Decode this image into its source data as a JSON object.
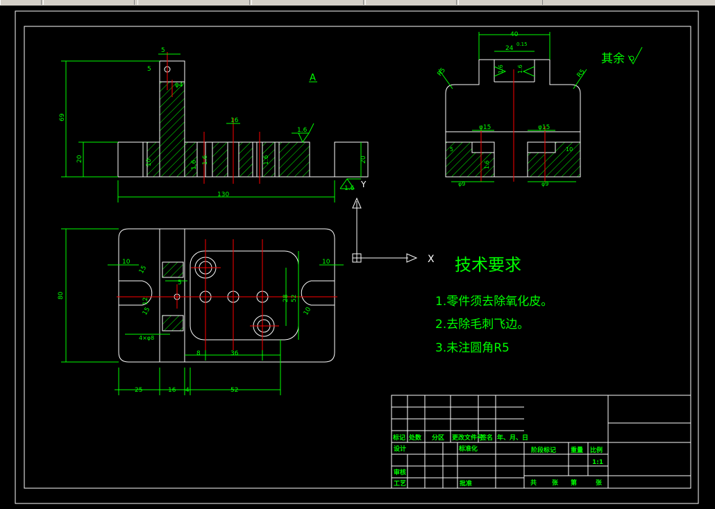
{
  "title_block": {
    "row_headers": [
      "标记",
      "处数",
      "分区",
      "更改文件号",
      "签名",
      "年、月、日"
    ],
    "design": "设计",
    "standardization": "标准化",
    "review": "审核",
    "process": "工艺",
    "approve": "批准",
    "stage_mark": "阶段标记",
    "weight": "重量",
    "scale": "比例",
    "scale_value": "1:1",
    "total": "共",
    "sheets": "张",
    "sheet_no": "第",
    "sheet_label": "张"
  },
  "tech": {
    "heading": "技术要求",
    "items": [
      "1.零件须去除氧化皮。",
      "2.去除毛刺飞边。",
      "3.未注圆角R5"
    ]
  },
  "rough": {
    "qiyu": "其余"
  },
  "dims": {
    "front": {
      "d5": "5",
      "d5v": "5",
      "d69": "69",
      "d20": "20",
      "d20r": "20",
      "d130": "130",
      "d10": "10",
      "d16": "16",
      "phi4": "φ4",
      "r16a": "1.6",
      "r16b": "1.6",
      "r16c": "1.6",
      "r16d": "1.6",
      "r16e": "1.6",
      "view": "A"
    },
    "side": {
      "d40": "40",
      "d24": "24",
      "tol": "0.15",
      "r16": "1.6",
      "r16b": "1.6",
      "r16c": "1.6",
      "r5a": "R5",
      "r5b": "R5",
      "phi15a": "φ15",
      "phi15b": "φ15",
      "d5": "5",
      "d10": "10",
      "phi9a": "φ9",
      "phi9b": "φ9"
    },
    "top": {
      "d80": "80",
      "d10a": "10",
      "d10b": "10",
      "d25": "25",
      "d16": "16",
      "d4": "4",
      "d52": "52",
      "d8": "8",
      "d36": "36",
      "d5": "5",
      "d28": "28",
      "d52v": "52",
      "r15": "15",
      "r12": "12",
      "r10": "10",
      "d15": "15",
      "note": "4×φ8"
    }
  },
  "ucs": {
    "x": "X",
    "y": "Y"
  },
  "colors": {
    "outline": "#ffffff",
    "dim": "#00ff00",
    "center": "#ff0000",
    "hatch": "#00ff00"
  }
}
